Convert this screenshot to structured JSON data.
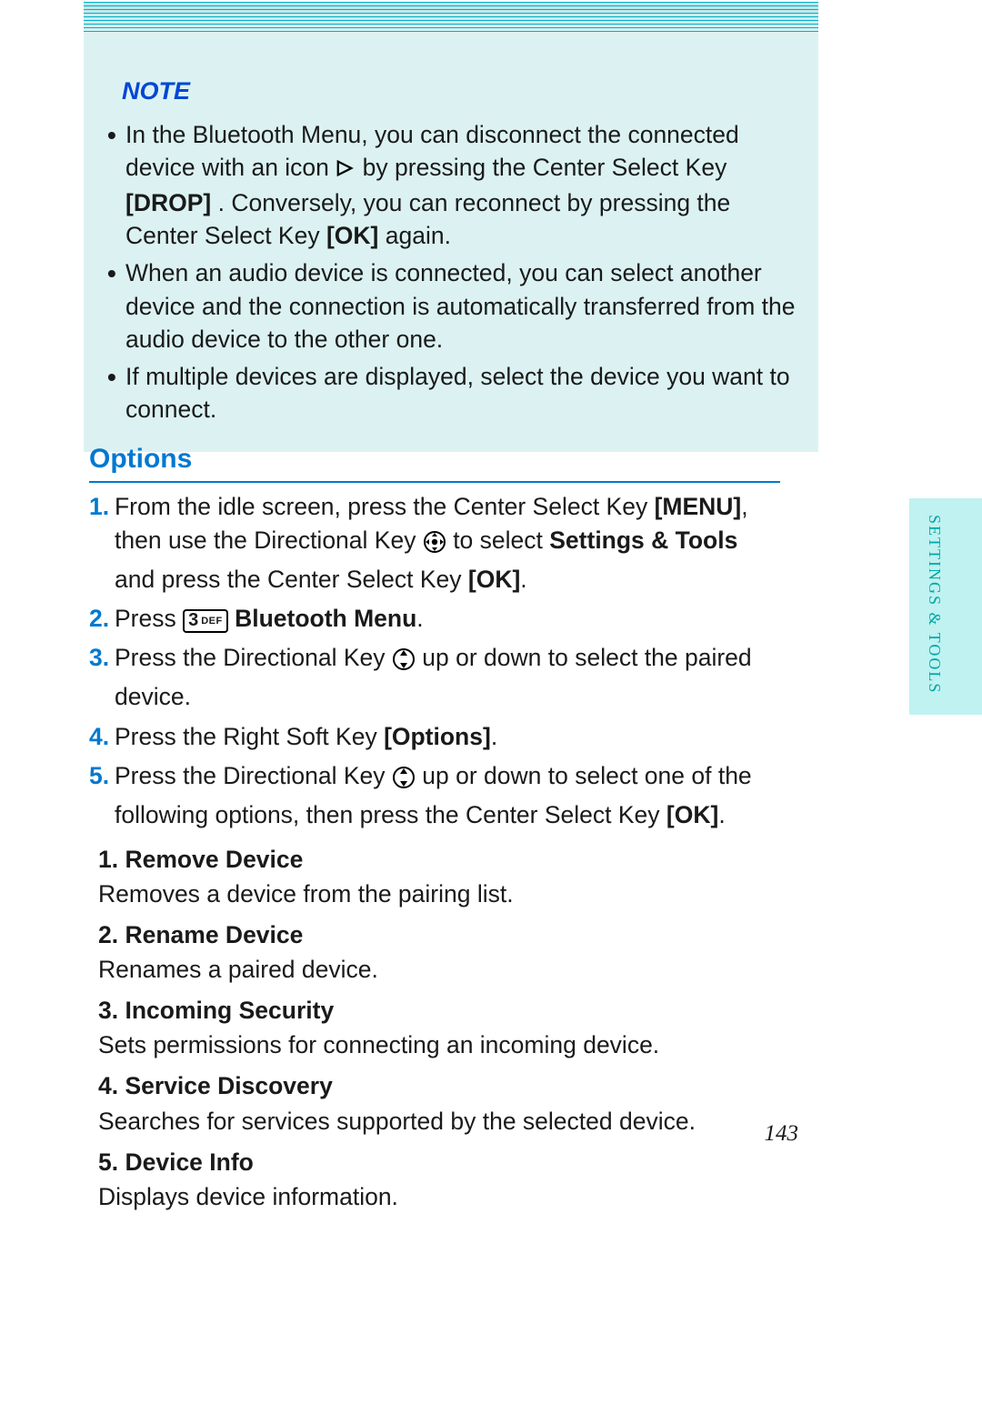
{
  "note": {
    "title": "NOTE",
    "items": [
      {
        "pre": "In the Bluetooth Menu, you can disconnect the connected device with an icon ",
        "mid1": " by pressing the Center Select Key ",
        "mid2": ". Conversely, you can reconnect by pressing the Center Select Key ",
        "bold1": "[DROP]",
        "bold2": "[OK]",
        "post": " again."
      },
      {
        "text": "When an audio device is connected, you can select another device and the connection is automatically transferred from the audio device to the other one."
      },
      {
        "text": "If multiple devices are displayed, select the device you want to connect."
      }
    ]
  },
  "options": {
    "title": "Options",
    "steps": {
      "s1": {
        "num": "1.",
        "a": "From the idle screen, press the Center Select Key ",
        "b": "[MENU]",
        "c": ", then use the Directional Key ",
        "d": " to select ",
        "e": "Settings & Tools",
        "f": " and press the Center Select Key ",
        "g": "[OK]",
        "h": "."
      },
      "s2": {
        "num": "2.",
        "a": "Press ",
        "b": " Bluetooth Menu",
        "c": "."
      },
      "s3": {
        "num": "3.",
        "a": "Press the Directional Key ",
        "b": " up or down to select the paired device."
      },
      "s4": {
        "num": "4.",
        "a": "Press the Right Soft Key ",
        "b": "[Options]",
        "c": "."
      },
      "s5": {
        "num": "5.",
        "a": "Press the Directional Key ",
        "b": " up or down to select one of the following options, then press the Center Select Key ",
        "c": "[OK]",
        "d": "."
      }
    },
    "sub": [
      {
        "label": "1. Remove Device",
        "desc": "Removes a device from the pairing list."
      },
      {
        "label": "2. Rename Device",
        "desc": "Renames a paired device."
      },
      {
        "label": "3. Incoming Security",
        "desc": "Sets permissions for connecting an incoming device."
      },
      {
        "label": "4. Service Discovery",
        "desc": "Searches for services supported by the selected device."
      },
      {
        "label": "5. Device Info",
        "desc": "Displays device information."
      }
    ]
  },
  "key3": {
    "three": "3",
    "def": "DEF"
  },
  "sideTab": "SETTINGS & TOOLS",
  "pageNumber": "143"
}
